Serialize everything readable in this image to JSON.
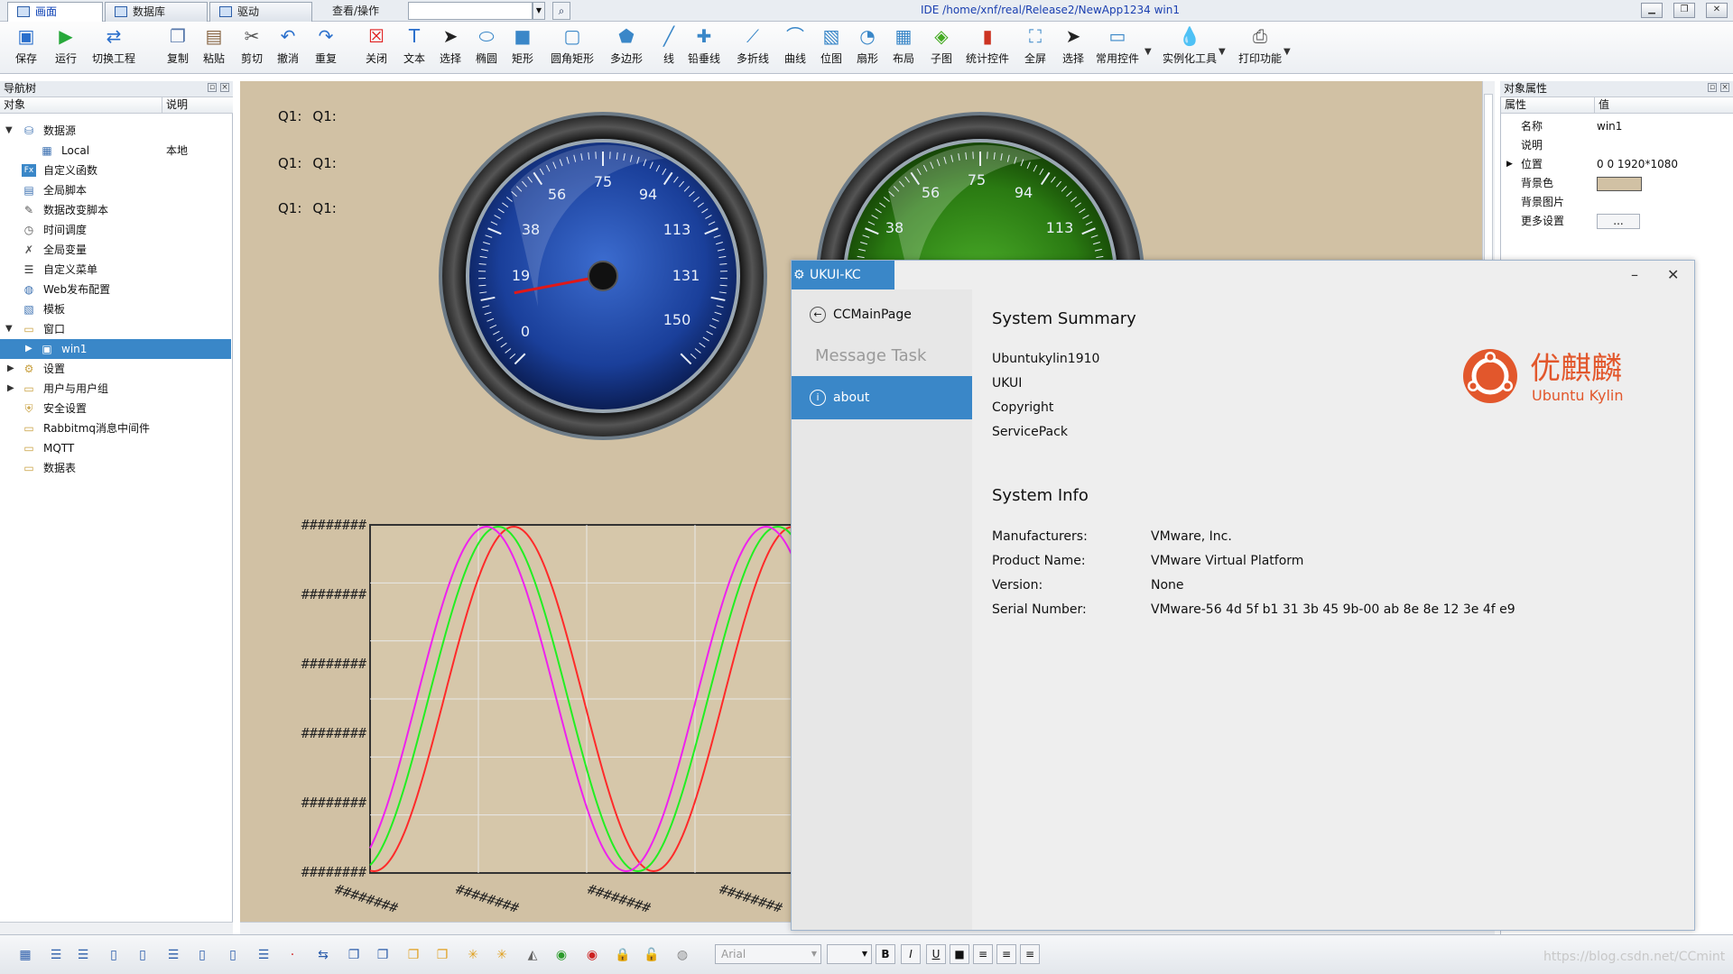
{
  "tabs": [
    {
      "label": "画面"
    },
    {
      "label": "数据库"
    },
    {
      "label": "驱动"
    }
  ],
  "query": {
    "label": "查看/操作",
    "value": ""
  },
  "window_title": "IDE /home/xnf/real/Release2/NewApp1234  win1",
  "toolbar": [
    {
      "label": "保存",
      "icon": "save-icon"
    },
    {
      "label": "运行",
      "icon": "run-icon"
    },
    {
      "label": "切换工程",
      "icon": "switch-project-icon"
    },
    {
      "label": "复制",
      "icon": "copy-icon"
    },
    {
      "label": "粘贴",
      "icon": "paste-icon"
    },
    {
      "label": "剪切",
      "icon": "cut-icon"
    },
    {
      "label": "撤消",
      "icon": "undo-icon"
    },
    {
      "label": "重复",
      "icon": "redo-icon"
    },
    {
      "label": "关闭",
      "icon": "close-icon"
    },
    {
      "label": "文本",
      "icon": "text-icon"
    },
    {
      "label": "选择",
      "icon": "pointer-icon"
    },
    {
      "label": "椭圆",
      "icon": "ellipse-icon"
    },
    {
      "label": "矩形",
      "icon": "rectangle-icon"
    },
    {
      "label": "圆角矩形",
      "icon": "rounded-rect-icon"
    },
    {
      "label": "多边形",
      "icon": "polygon-icon"
    },
    {
      "label": "线",
      "icon": "line-icon"
    },
    {
      "label": "铅垂线",
      "icon": "plumb-line-icon"
    },
    {
      "label": "多折线",
      "icon": "polyline-icon"
    },
    {
      "label": "曲线",
      "icon": "curve-icon"
    },
    {
      "label": "位图",
      "icon": "bitmap-icon"
    },
    {
      "label": "扇形",
      "icon": "sector-icon"
    },
    {
      "label": "布局",
      "icon": "layout-icon"
    },
    {
      "label": "子图",
      "icon": "subgraph-icon"
    },
    {
      "label": "统计控件",
      "icon": "statistics-icon"
    },
    {
      "label": "全屏",
      "icon": "fullscreen-icon"
    },
    {
      "label": "选择",
      "icon": "select-icon"
    },
    {
      "label": "常用控件",
      "icon": "common-controls-icon"
    },
    {
      "label": "实例化工具",
      "icon": "instantiate-tool-icon"
    },
    {
      "label": "打印功能",
      "icon": "print-icon"
    }
  ],
  "nav": {
    "title": "导航树",
    "col_object": "对象",
    "col_desc": "说明",
    "items": [
      {
        "label": "数据源",
        "desc": ""
      },
      {
        "label": "Local",
        "desc": "本地"
      },
      {
        "label": "自定义函数",
        "desc": ""
      },
      {
        "label": "全局脚本",
        "desc": ""
      },
      {
        "label": "数据改变脚本",
        "desc": ""
      },
      {
        "label": "时间调度",
        "desc": ""
      },
      {
        "label": "全局变量",
        "desc": ""
      },
      {
        "label": "自定义菜单",
        "desc": ""
      },
      {
        "label": "Web发布配置",
        "desc": ""
      },
      {
        "label": "模板",
        "desc": ""
      },
      {
        "label": "窗口",
        "desc": ""
      },
      {
        "label": "win1",
        "desc": ""
      },
      {
        "label": "设置",
        "desc": ""
      },
      {
        "label": "用户与用户组",
        "desc": ""
      },
      {
        "label": "安全设置",
        "desc": ""
      },
      {
        "label": "Rabbitmq消息中间件",
        "desc": ""
      },
      {
        "label": "MQTT",
        "desc": ""
      },
      {
        "label": "数据表",
        "desc": ""
      }
    ]
  },
  "canvas": {
    "bg_color": "#d1c1a4",
    "q_labels": [
      {
        "a": "Q1:",
        "b": "Q1:"
      },
      {
        "a": "Q1:",
        "b": "Q1:"
      },
      {
        "a": "Q1:",
        "b": "Q1:"
      }
    ],
    "gauge_ticks": [
      "0",
      "19",
      "38",
      "56",
      "75",
      "94",
      "113",
      "131",
      "150"
    ],
    "gauge2_ticks": [
      "38",
      "56",
      "75",
      "94",
      "113"
    ],
    "gauge_value": 19,
    "y_labels": [
      "########",
      "########",
      "########",
      "########",
      "########",
      "########"
    ],
    "x_labels": [
      "########",
      "########",
      "########",
      "########"
    ]
  },
  "chart_data": {
    "type": "line",
    "title": "",
    "xlabel": "",
    "ylabel": "",
    "grid": true,
    "series": [
      {
        "color": "#ff2a2a",
        "phase_deg": 35,
        "amplitude": 1
      },
      {
        "color": "#22ee22",
        "phase_deg": 15,
        "amplitude": 1
      },
      {
        "color": "#ee22ee",
        "phase_deg": 0,
        "amplitude": 1
      }
    ]
  },
  "props": {
    "title": "对象属性",
    "col_attr": "属性",
    "col_value": "值",
    "rows": [
      {
        "attr": "名称",
        "value": "win1"
      },
      {
        "attr": "说明",
        "value": ""
      },
      {
        "attr": "位置",
        "value": "0 0 1920*1080"
      },
      {
        "attr": "背景色",
        "value": ""
      },
      {
        "attr": "背景图片",
        "value": ""
      },
      {
        "attr": "更多设置",
        "value": "..."
      }
    ],
    "bg_swatch": "#d1c1a4"
  },
  "statusbar": {
    "font": "Arial",
    "bold": "B",
    "italic": "I",
    "underline": "U",
    "watermark": "https://blog.csdn.net/CCmint"
  },
  "dialog": {
    "title": "UKUI-KC",
    "side": [
      {
        "label": "CCMainPage"
      },
      {
        "label": "Message Task"
      },
      {
        "label": "about"
      }
    ],
    "summary_title": "System Summary",
    "summary": [
      "Ubuntukylin1910",
      "UKUI",
      "Copyright",
      "ServicePack"
    ],
    "info_title": "System Info",
    "info": [
      {
        "k": "Manufacturers:",
        "v": "VMware, Inc."
      },
      {
        "k": "Product Name:",
        "v": "VMware Virtual Platform"
      },
      {
        "k": "Version:",
        "v": "None"
      },
      {
        "k": "Serial Number:",
        "v": "VMware-56 4d 5f b1 31 3b 45 9b-00 ab 8e 8e 12 3e 4f e9"
      }
    ],
    "logo_cn": "优麒麟",
    "logo_en": "Ubuntu Kylin",
    "accent": "#e2572c"
  }
}
